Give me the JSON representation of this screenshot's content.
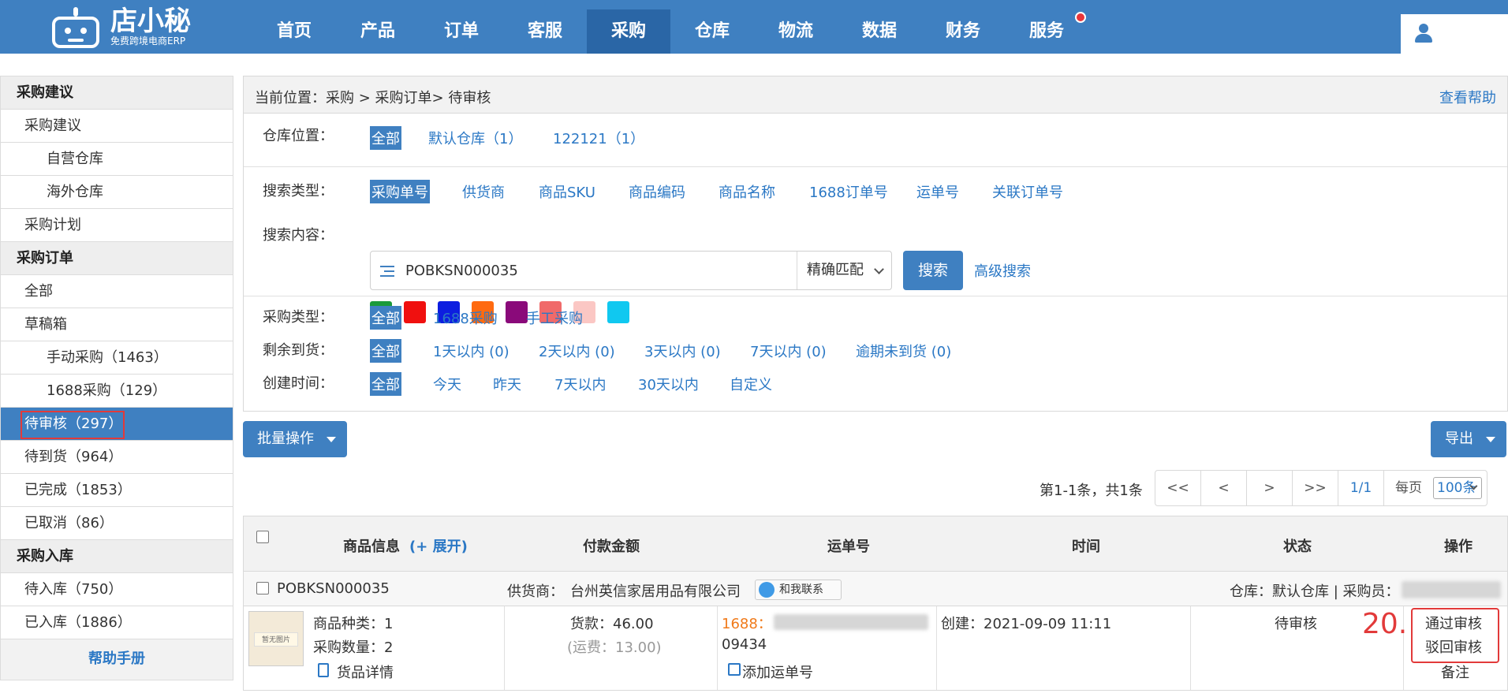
{
  "app": {
    "logo_name": "店小秘",
    "logo_sub": "免费跨境电商ERP"
  },
  "nav": [
    {
      "label": "首页"
    },
    {
      "label": "产品"
    },
    {
      "label": "订单"
    },
    {
      "label": "客服"
    },
    {
      "label": "采购",
      "active": true
    },
    {
      "label": "仓库"
    },
    {
      "label": "物流"
    },
    {
      "label": "数据"
    },
    {
      "label": "财务"
    },
    {
      "label": "服务",
      "badge_dot": true
    }
  ],
  "sidebar": {
    "groups": [
      {
        "title": "采购建议",
        "items": [
          {
            "label": "采购建议",
            "level": 1
          },
          {
            "label": "自营仓库",
            "level": 2
          },
          {
            "label": "海外仓库",
            "level": 2
          },
          {
            "label": "采购计划",
            "level": 1
          }
        ]
      },
      {
        "title": "采购订单",
        "items": [
          {
            "label": "全部",
            "level": 1
          },
          {
            "label": "草稿箱",
            "level": 1
          },
          {
            "label": "手动采购（1463）",
            "level": 2
          },
          {
            "label": "1688采购（129）",
            "level": 2
          },
          {
            "label": "待审核（297）",
            "level": 1,
            "active": true
          },
          {
            "label": "待到货（964）",
            "level": 1
          },
          {
            "label": "已完成（1853）",
            "level": 1
          },
          {
            "label": "已取消（86）",
            "level": 1
          }
        ]
      },
      {
        "title": "采购入库",
        "items": [
          {
            "label": "待入库（750）",
            "level": 1
          },
          {
            "label": "已入库（1886）",
            "level": 1
          }
        ]
      }
    ],
    "help": "帮助手册"
  },
  "breadcrumb": {
    "text": "当前位置：采购 > 采购订单> 待审核",
    "help": "查看帮助"
  },
  "filters": {
    "warehouse": {
      "label": "仓库位置：",
      "options": [
        "全部",
        "默认仓库（1）",
        "122121（1）"
      ]
    },
    "search_type": {
      "label": "搜索类型：",
      "options": [
        "采购单号",
        "供货商",
        "商品SKU",
        "商品编码",
        "商品名称",
        "1688订单号",
        "运单号",
        "关联订单号"
      ]
    },
    "search_content": {
      "label": "搜索内容：",
      "value": "POBKSN000035",
      "match": "精确匹配",
      "search_btn": "搜索",
      "advanced": "高级搜索"
    },
    "color_tags": [
      "#1a9a3a",
      "#f0100f",
      "#0d1ee0",
      "#ff6a10",
      "#8a0a7a",
      "#f06a6a",
      "#fbc7c4",
      "#10c8f0"
    ],
    "purchase_type": {
      "label": "采购类型：",
      "options": [
        "全部",
        "1688采购",
        "手工采购"
      ]
    },
    "remaining": {
      "label": "剩余到货：",
      "options": [
        "全部",
        "1天以内 (0)",
        "2天以内 (0)",
        "3天以内 (0)",
        "7天以内 (0)",
        "逾期未到货 (0)"
      ]
    },
    "created": {
      "label": "创建时间：",
      "options": [
        "全部",
        "今天",
        "昨天",
        "7天以内",
        "30天以内",
        "自定义"
      ]
    }
  },
  "toolbar": {
    "batch": "批量操作",
    "export": "导出"
  },
  "pager": {
    "info": "第1-1条，共1条",
    "buttons": [
      "<<",
      "<",
      ">",
      ">>"
    ],
    "current": "1/1",
    "per_page_label": "每页",
    "per_page": "100条"
  },
  "table": {
    "headers": {
      "product": "商品信息",
      "expand": "(+ 展开)",
      "amount": "付款金额",
      "tracking": "运单号",
      "time": "时间",
      "status": "状态",
      "ops": "操作"
    },
    "order": {
      "number": "POBKSN000035",
      "supplier_label": "供货商：",
      "supplier": "台州英信家居用品有限公司",
      "contact": "和我联系",
      "warehouse_info": "仓库：默认仓库 | 采购员："
    },
    "detail": {
      "thumb_label": "暂无图片",
      "kinds": "商品种类：1",
      "qty": "采购数量：2",
      "goods_detail": "货品详情",
      "goods_amount": "货款：46.00",
      "freight": "(运费：13.00)",
      "tracking_prefix": "1688：",
      "tracking_tail": "09434",
      "add_tracking": "添加运单号",
      "created": "创建：2021-09-09 11:11",
      "status": "待审核",
      "step": "20.",
      "approve": "通过审核",
      "reject": "驳回审核",
      "remark": "备注"
    }
  }
}
